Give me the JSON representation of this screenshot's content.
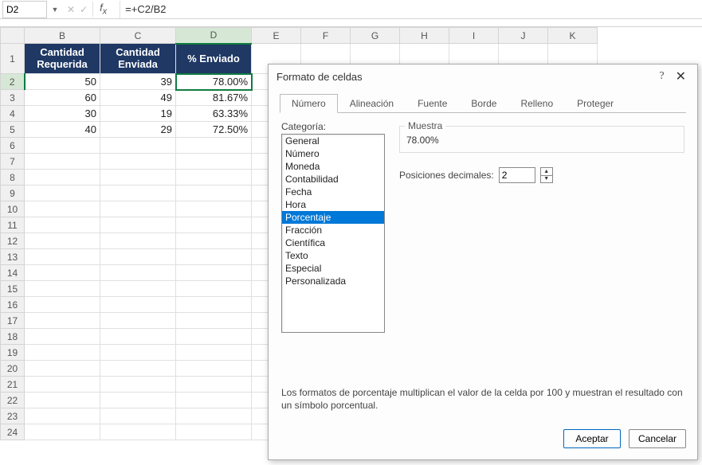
{
  "name_box": "D2",
  "formula": "=+C2/B2",
  "columns": [
    "B",
    "C",
    "D",
    "E",
    "F",
    "G",
    "H",
    "I",
    "J",
    "K"
  ],
  "sel_col": "D",
  "col_widths": {
    "B": 95,
    "C": 95,
    "D": 95,
    "E": 62,
    "F": 62,
    "G": 62,
    "H": 62,
    "I": 62,
    "J": 62,
    "K": 62
  },
  "headers": {
    "B": "Cantidad Requerida",
    "C": "Cantidad Enviada",
    "D": "% Enviado"
  },
  "sel_row": 2,
  "rows": [
    {
      "n": 1,
      "tall": true,
      "B": null,
      "C": null,
      "D": null
    },
    {
      "n": 2,
      "B": "50",
      "C": "39",
      "D": "78.00%",
      "active": "D"
    },
    {
      "n": 3,
      "B": "60",
      "C": "49",
      "D": "81.67%"
    },
    {
      "n": 4,
      "B": "30",
      "C": "19",
      "D": "63.33%"
    },
    {
      "n": 5,
      "B": "40",
      "C": "29",
      "D": "72.50%"
    },
    {
      "n": 6
    },
    {
      "n": 7
    },
    {
      "n": 8
    },
    {
      "n": 9
    },
    {
      "n": 10
    },
    {
      "n": 11
    },
    {
      "n": 12
    },
    {
      "n": 13
    },
    {
      "n": 14
    },
    {
      "n": 15
    },
    {
      "n": 16
    },
    {
      "n": 17
    },
    {
      "n": 18
    },
    {
      "n": 19
    },
    {
      "n": 20
    },
    {
      "n": 21
    },
    {
      "n": 22
    },
    {
      "n": 23
    },
    {
      "n": 24
    }
  ],
  "dialog": {
    "title": "Formato de celdas",
    "tabs": [
      "Número",
      "Alineación",
      "Fuente",
      "Borde",
      "Relleno",
      "Proteger"
    ],
    "active_tab": "Número",
    "category_label": "Categoría:",
    "categories": [
      "General",
      "Número",
      "Moneda",
      "Contabilidad",
      "Fecha",
      "Hora",
      "Porcentaje",
      "Fracción",
      "Científica",
      "Texto",
      "Especial",
      "Personalizada"
    ],
    "selected_category": "Porcentaje",
    "sample_label": "Muestra",
    "sample_value": "78.00%",
    "decimals_label": "Posiciones decimales:",
    "decimals_value": "2",
    "description": "Los formatos de porcentaje multiplican el valor de la celda por 100 y muestran el resultado con un símbolo porcentual.",
    "ok": "Aceptar",
    "cancel": "Cancelar"
  }
}
